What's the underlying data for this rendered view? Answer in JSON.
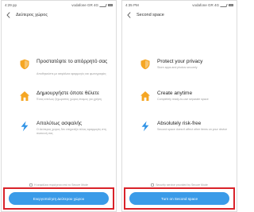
{
  "colors": {
    "accent": "#3a9be8",
    "icon_orange": "#f5a623",
    "icon_blue": "#2f93e6",
    "highlight": "#d9232a"
  },
  "left": {
    "status": {
      "time": "4:29 pp",
      "carrier": "vodafone GR 4G"
    },
    "title": "Δεύτερος χώρος",
    "features": [
      {
        "icon": "shield-icon",
        "title": "Προστατέψτε το απόρρητό σας",
        "desc": "Αποθηκεύστε με ασφάλεια εφαρμογές και φωτογραφίες"
      },
      {
        "icon": "home-icon",
        "title": "Δημιουργήστε όποτε θέλετε",
        "desc": "Ένας εντελώς ξεχωριστός χώρος έτοιμος για χρήση"
      },
      {
        "icon": "lightning-icon",
        "title": "Απολύτως ασφαλής",
        "desc": "Ο Δεύτερος χώρος δεν επηρεάζει άλλες εφαρμογές στη συσκευή σας"
      }
    ],
    "footer_note": "Η ασφάλεια παρέχεται από το Secure Mode",
    "button_label": "Ενεργοποίηση Δεύτερου χώρου"
  },
  "right": {
    "status": {
      "time": "4:35 PM",
      "carrier": "vodafone GR 4G"
    },
    "title": "Second space",
    "features": [
      {
        "icon": "shield-icon",
        "title": "Protect your privacy",
        "desc": "Store apps and photos securely"
      },
      {
        "icon": "home-icon",
        "title": "Create anytime",
        "desc": "Completely ready-to-use separate space"
      },
      {
        "icon": "lightning-icon",
        "title": "Absolutely risk-free",
        "desc": "Second space doesn't affect other items on your device"
      }
    ],
    "footer_note": "Security service provided by Secure Mode",
    "button_label": "Turn on Second space"
  }
}
